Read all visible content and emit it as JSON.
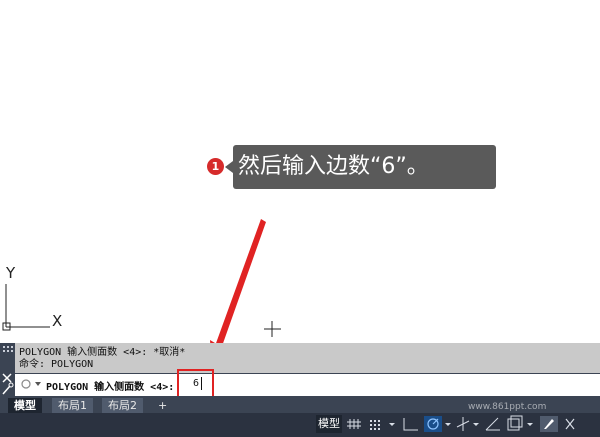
{
  "callout": {
    "badge": "1",
    "text": "然后输入边数“6”。"
  },
  "history": {
    "line1": "POLYGON 输入侧面数 <4>: *取消*",
    "line2": "命令:  POLYGON"
  },
  "command_line": {
    "prompt": "POLYGON 输入侧面数 <4>:",
    "value": "6"
  },
  "layout_tabs": [
    {
      "label": "模型",
      "active": true
    },
    {
      "label": "布局1",
      "active": false
    },
    {
      "label": "布局2",
      "active": false
    },
    {
      "label": "+",
      "active": false
    }
  ],
  "status_bar": {
    "model_label": "模型"
  },
  "ucs": {
    "x_label": "X",
    "y_label": "Y"
  },
  "watermark": {
    "brand": "861PPT",
    "url": "www.861ppt.com"
  },
  "colors": {
    "highlight": "#e02323",
    "callout_bg": "#5a5a5a",
    "badge": "#d62b2b",
    "panel": "#3b4453"
  }
}
